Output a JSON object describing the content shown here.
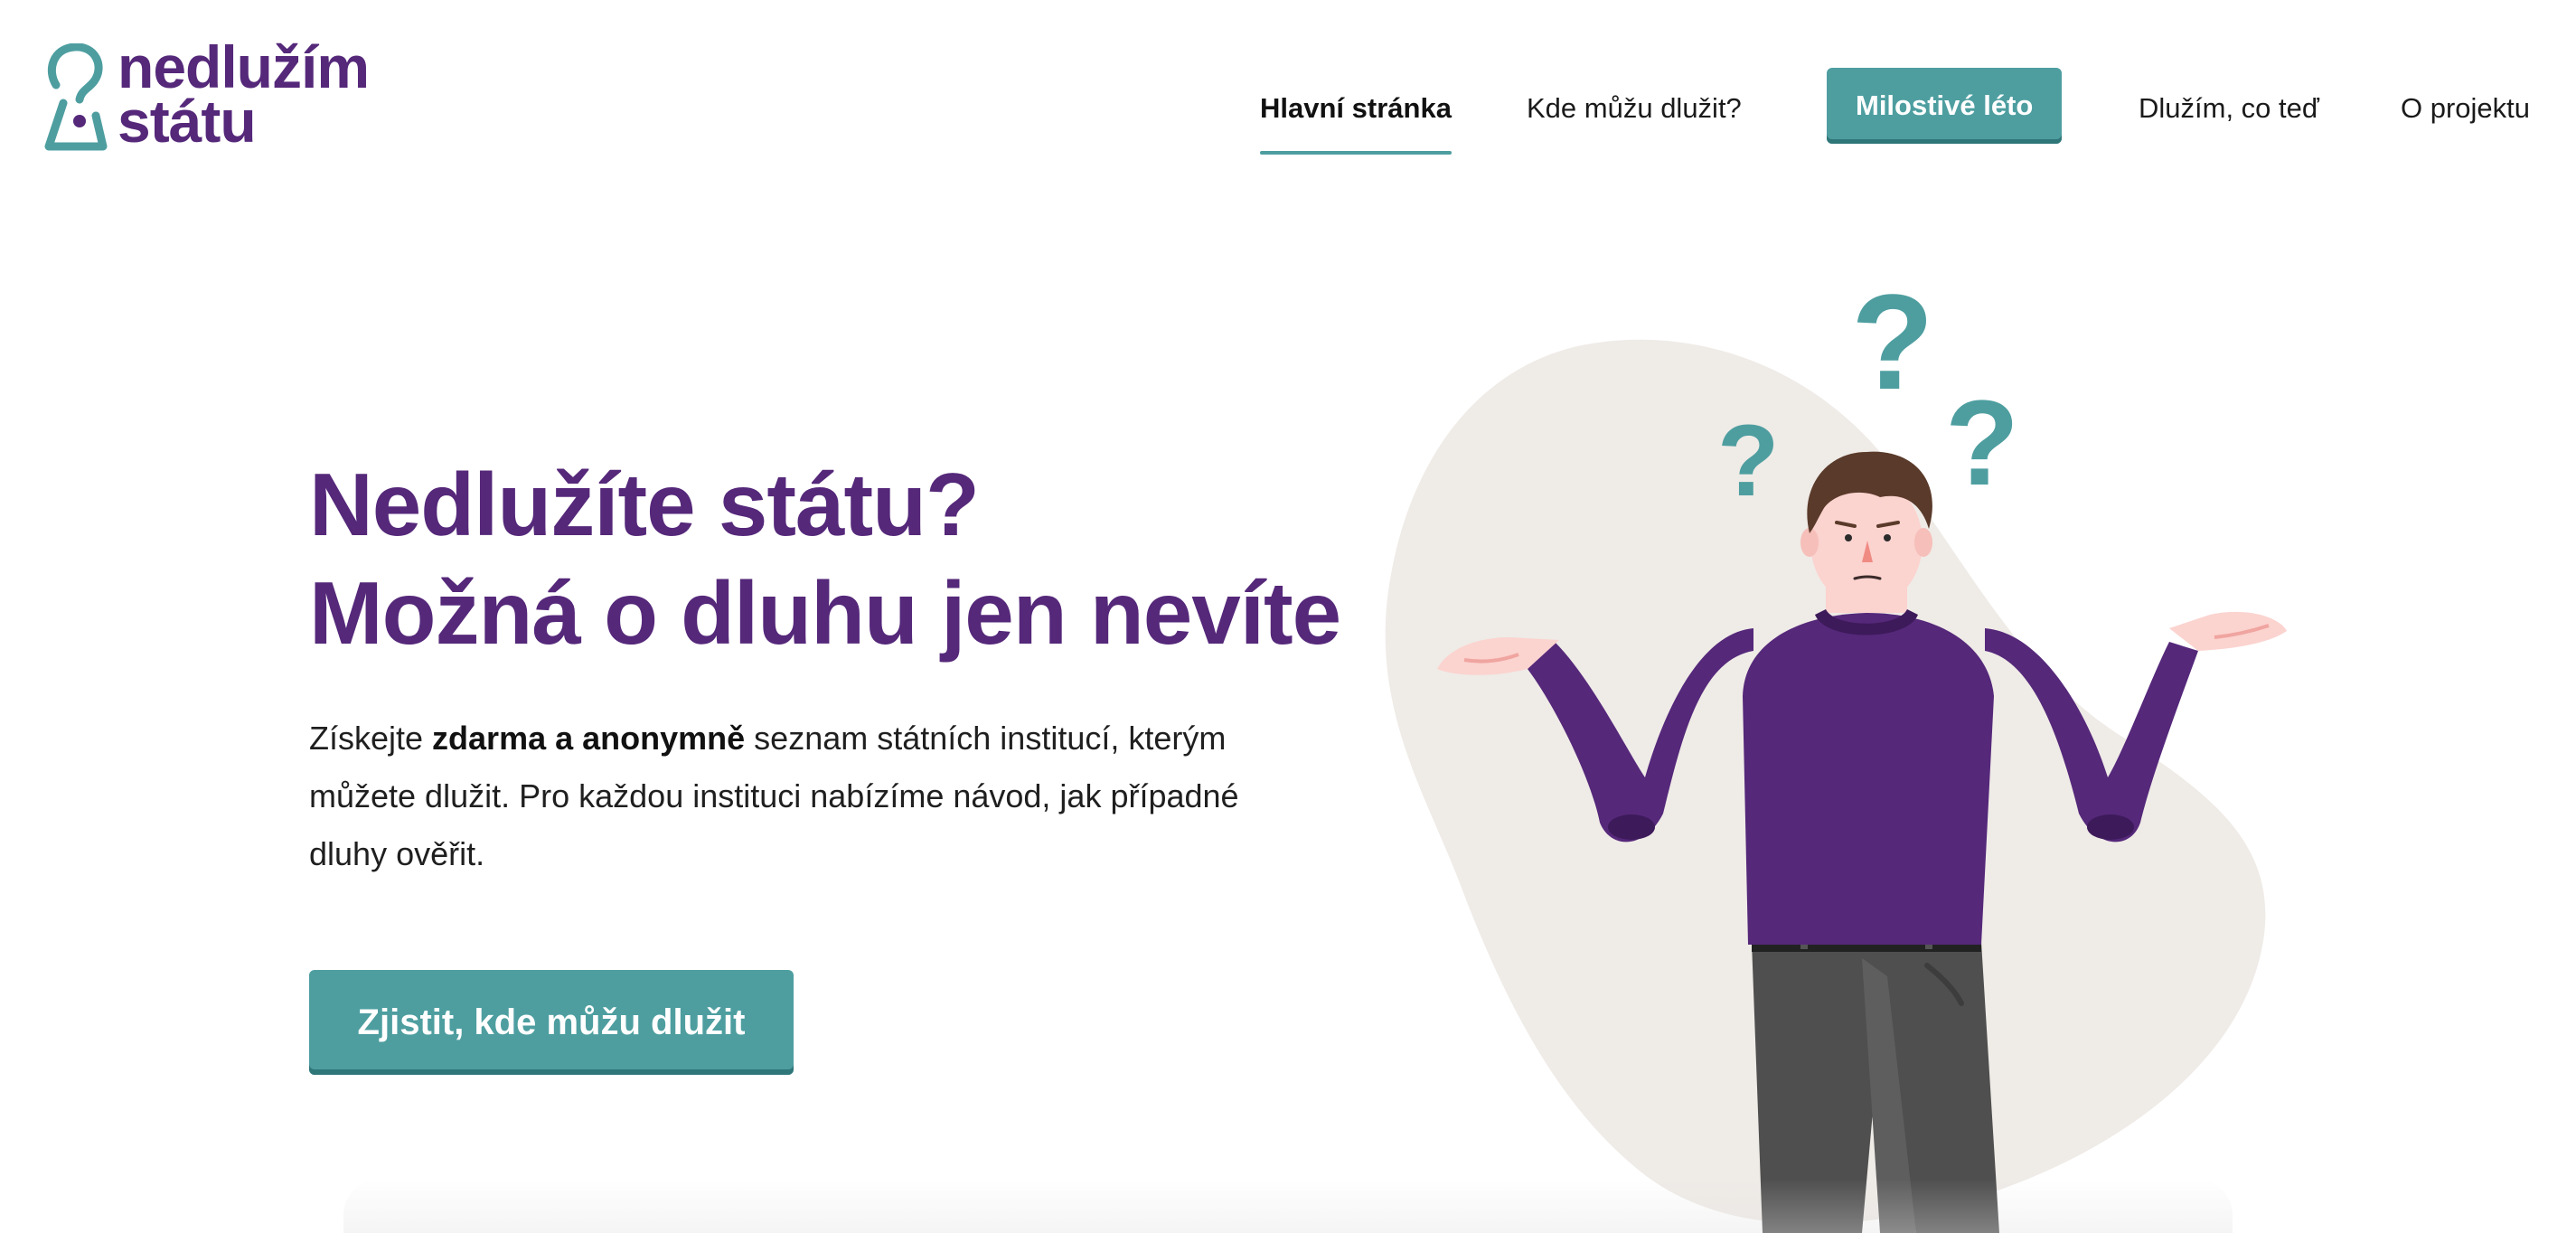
{
  "brand": {
    "line1": "nedlužím",
    "line2": "státu",
    "logo_icon": "keyhole-question-icon",
    "colors": {
      "purple": "#55287a",
      "teal": "#4e9ea0",
      "teal_dark": "#2f7679"
    }
  },
  "nav": {
    "items": [
      {
        "label": "Hlavní stránka",
        "active": true
      },
      {
        "label": "Kde můžu dlužit?"
      },
      {
        "label": "Milostivé léto",
        "highlight": true
      },
      {
        "label": "Dlužím, co teď"
      },
      {
        "label": "O projektu"
      }
    ]
  },
  "hero": {
    "title_line1": "Nedlužíte státu?",
    "title_line2": "Možná o dluhu jen nevíte",
    "text_prefix": "Získejte ",
    "text_bold": "zdarma a anonymně",
    "text_suffix": " seznam státních institucí, kterým můžete dlužit. Pro každou instituci nabízíme návod, jak případné dluhy ověřit.",
    "cta_label": "Zjistit, kde můžu dlužit"
  },
  "illustration": {
    "name": "confused-man-shrugging",
    "marks": [
      "?",
      "?",
      "?"
    ]
  }
}
